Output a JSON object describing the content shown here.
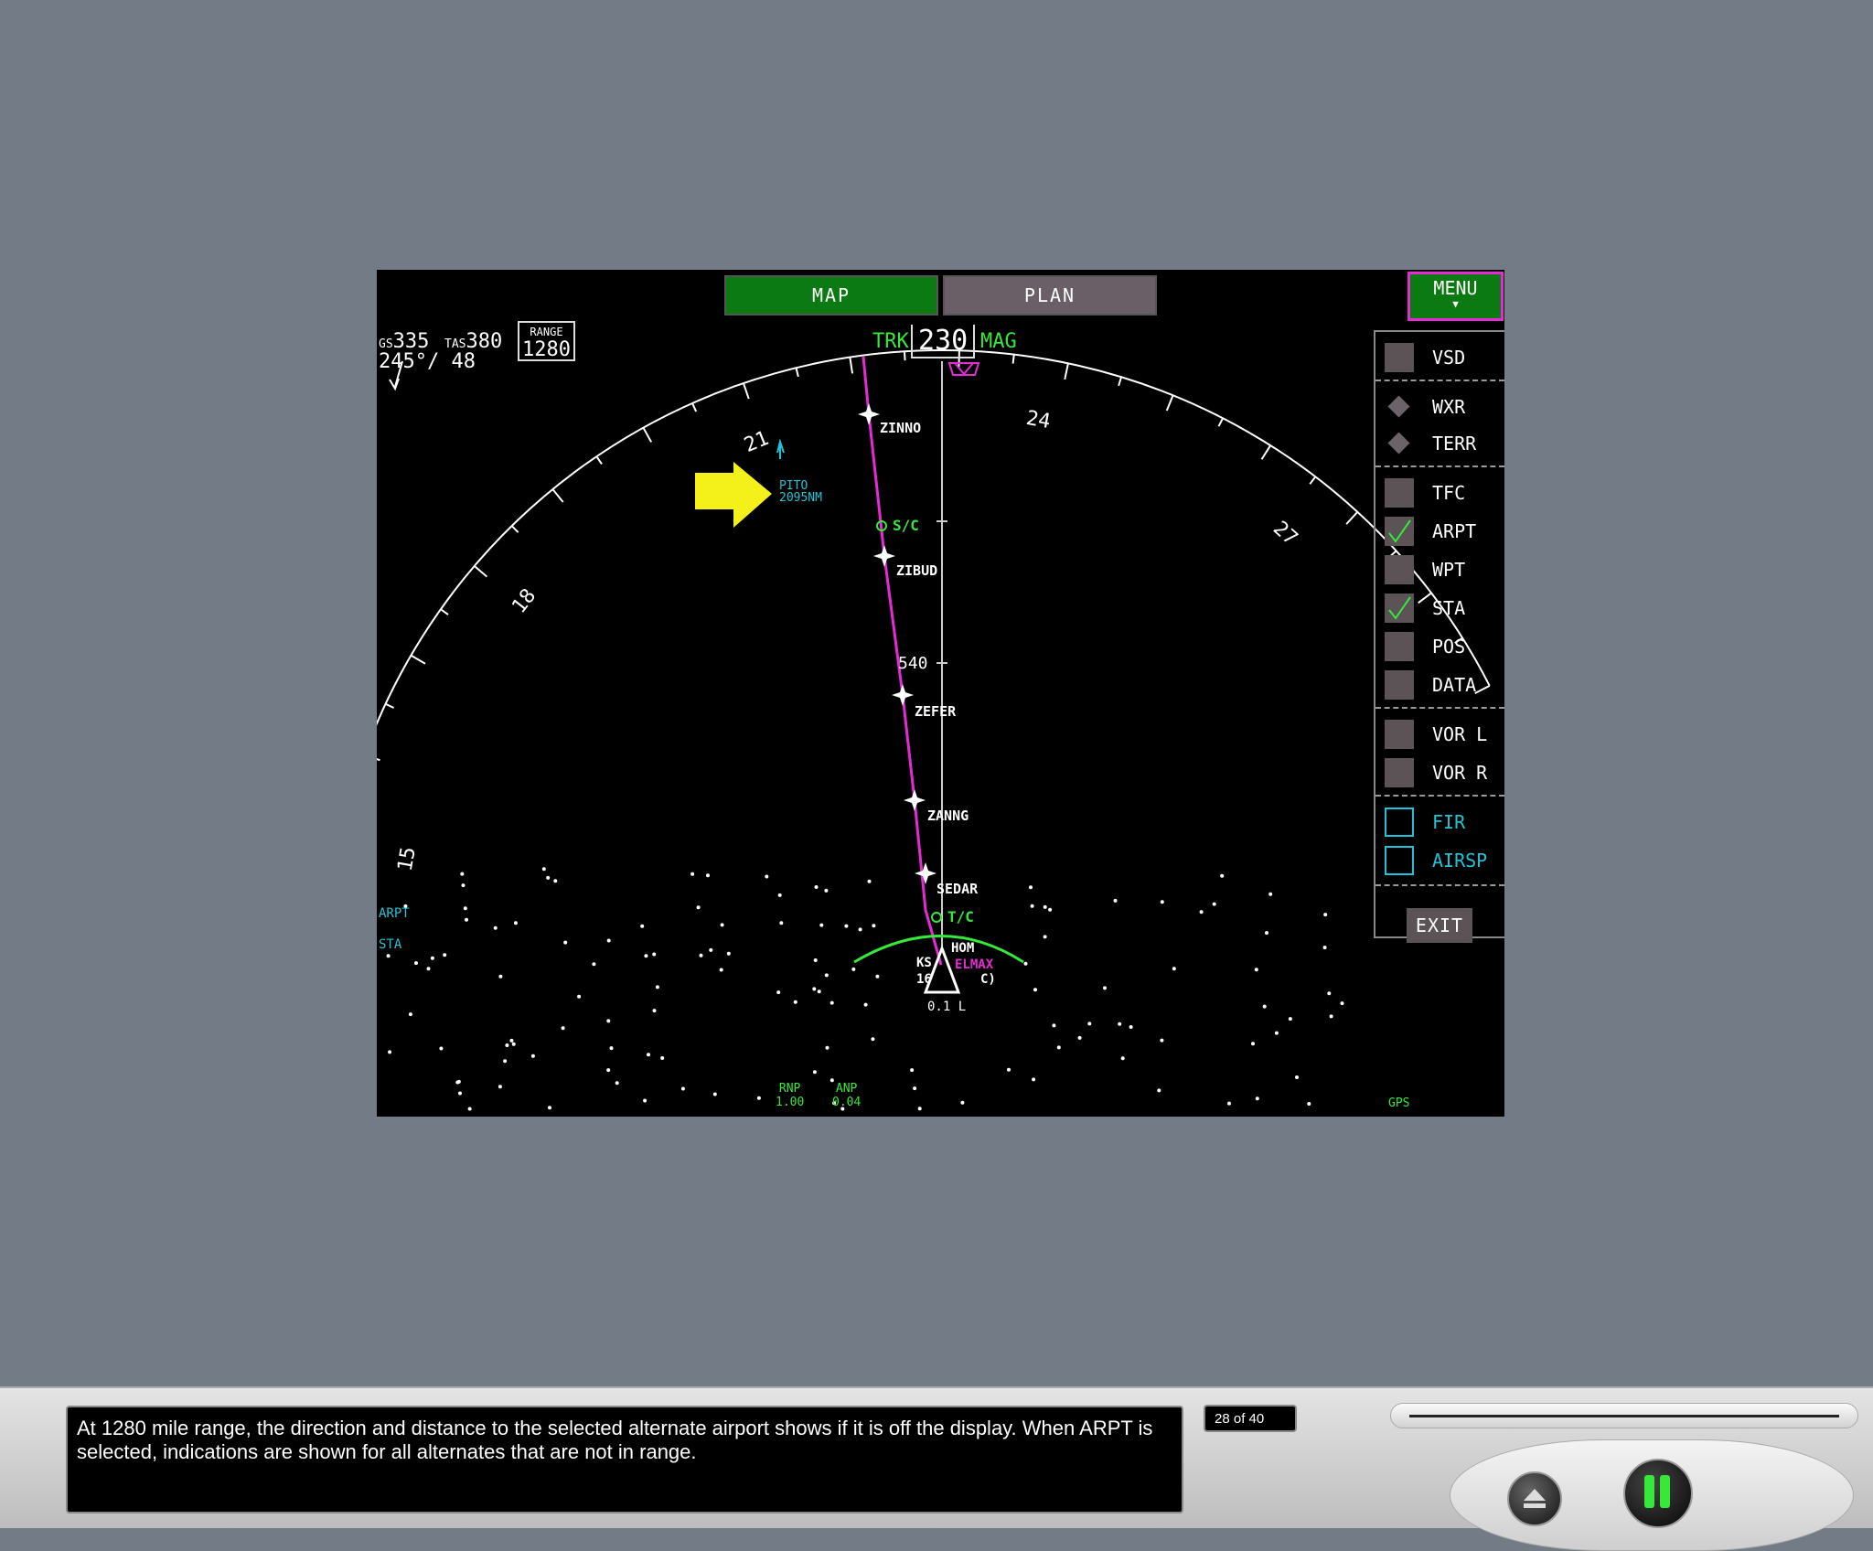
{
  "nd": {
    "modes": {
      "map": "MAP",
      "plan": "PLAN"
    },
    "menu_button": {
      "label": "MENU",
      "arrow": "▼"
    },
    "gs": {
      "prefix": "GS",
      "value": "335"
    },
    "tas": {
      "prefix": "TAS",
      "value": "380"
    },
    "wind": "245°/ 48",
    "range": {
      "label": "RANGE",
      "value": "1280"
    },
    "track": {
      "trk": "TRK",
      "value": "230",
      "mag": "MAG"
    },
    "compass_labels": [
      "15",
      "18",
      "21",
      "24",
      "27"
    ],
    "alternate": {
      "name": "PITO",
      "distance": "2095NM"
    },
    "waypoints": [
      "ZINNO",
      "S/C",
      "ZIBUD",
      "540",
      "ZEFER",
      "ZANNG",
      "SEDAR",
      "T/C",
      "HOM",
      "KS",
      "16",
      "ELMAX",
      "C)",
      "0.1 L"
    ],
    "left_indicators": {
      "arpt": "ARPT",
      "sta": "STA"
    },
    "rnp": {
      "label": "RNP",
      "value": "1.00"
    },
    "anp": {
      "label": "ANP",
      "value": "0.04"
    },
    "gps": "GPS",
    "menu_items": [
      {
        "label": "VSD",
        "state": "off"
      },
      {
        "label": "WXR",
        "state": "diamond"
      },
      {
        "label": "TERR",
        "state": "diamond"
      },
      {
        "label": "TFC",
        "state": "off"
      },
      {
        "label": "ARPT",
        "state": "checked"
      },
      {
        "label": "WPT",
        "state": "off"
      },
      {
        "label": "STA",
        "state": "checked"
      },
      {
        "label": "POS",
        "state": "off"
      },
      {
        "label": "DATA",
        "state": "off"
      },
      {
        "label": "VOR L",
        "state": "off"
      },
      {
        "label": "VOR R",
        "state": "off"
      },
      {
        "label": "FIR",
        "state": "cyan"
      },
      {
        "label": "AIRSP",
        "state": "cyan"
      }
    ],
    "exit_label": "EXIT",
    "colors": {
      "route": "#e62ad6",
      "green": "#35e83a",
      "cyan": "#22c3d8",
      "arrow": "#f4f11a"
    }
  },
  "player": {
    "caption": "At 1280 mile range, the direction and distance to the selected alternate airport shows if it is off the display. When ARPT is selected, indications are shown for all alternates that are not in range.",
    "counter": "28 of 40",
    "controls": {
      "eject_icon": "eject-icon",
      "pause_icon": "pause-icon"
    }
  }
}
